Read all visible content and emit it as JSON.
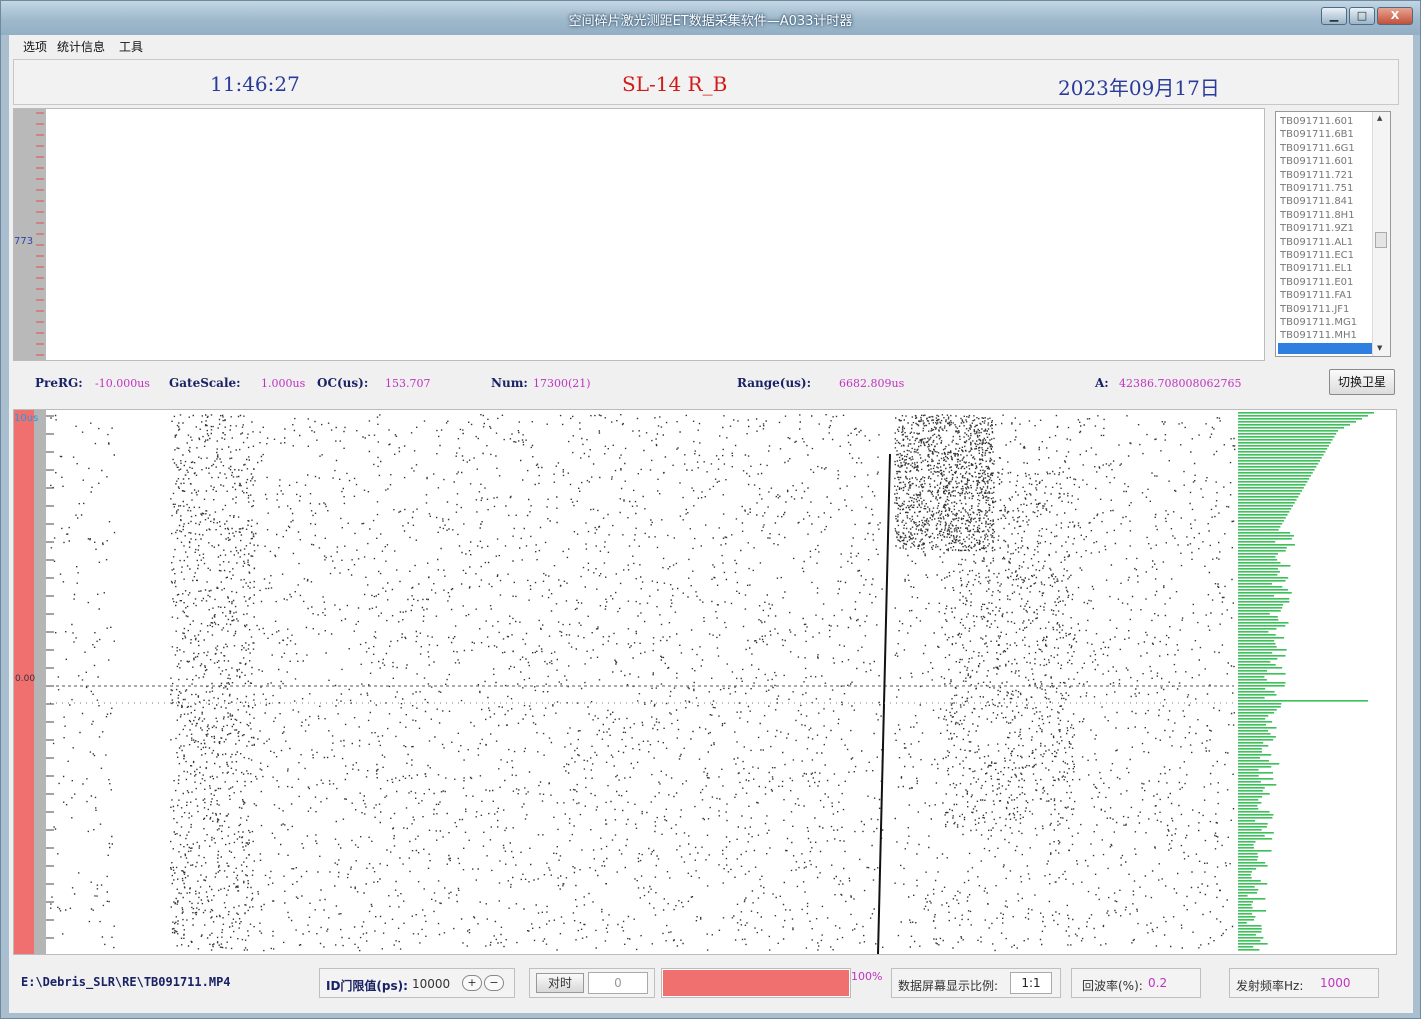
{
  "window": {
    "title": "空间碎片激光测距ET数据采集软件—A033计时器",
    "controls": {
      "minimize": "▁",
      "maximize": "□",
      "close": "X"
    }
  },
  "menu": [
    "选项",
    "统计信息",
    "工具"
  ],
  "header": {
    "time": "11:46:27",
    "target": "SL-14  R_B",
    "date": "2023年09月17日"
  },
  "top_plot": {
    "ruler_label": "773"
  },
  "file_list": {
    "items": [
      "TB091711.601",
      "TB091711.6B1",
      "TB091711.6G1",
      "TB091711.601",
      "TB091711.721",
      "TB091711.751",
      "TB091711.841",
      "TB091711.8H1",
      "TB091711.9Z1",
      "TB091711.AL1",
      "TB091711.EC1",
      "TB091711.EL1",
      "TB091711.E01",
      "TB091711.FA1",
      "TB091711.JF1",
      "TB091711.MG1",
      "TB091711.MH1"
    ],
    "selected_index": 17,
    "scroll_up": "▲",
    "scroll_down": "▼"
  },
  "info": {
    "prerg_label": "PreRG:",
    "prerg_value": "-10.000us",
    "gatescale_label": "GateScale:",
    "gatescale_value": "1.000us",
    "oc_label": "OC(us):",
    "oc_value": "153.707",
    "num_label": "Num:",
    "num_value": "17300(21)",
    "range_label": "Range(us):",
    "range_value": "6682.809us",
    "a_label": "A:",
    "a_value": "42386.708008062765",
    "switch_button": "切换卫星"
  },
  "main_plot": {
    "y_top_label": "10us",
    "y_zero_label": "0.00"
  },
  "status": {
    "file_path": "E:\\Debris_SLR\\RE\\TB091711.MP4",
    "id_threshold_label": "ID门限值(ps):",
    "id_threshold_value": "10000",
    "plus_button": "+",
    "minus_button": "−",
    "timing_button": "对时",
    "timing_value": "0",
    "progress_percent": 100,
    "progress_label": "100%",
    "ratio_label": "数据屏幕显示比例:",
    "ratio_value": "1:1",
    "echo_rate_label": "回波率(%):",
    "echo_rate_value": "0.2",
    "fire_rate_label": "发射频率Hz:",
    "fire_rate_value": "1000"
  },
  "colors": {
    "accent_red": "#f07070",
    "histogram_green": "#3cc05a",
    "label_blue": "#1a2266",
    "value_magenta": "#c033c0"
  }
}
